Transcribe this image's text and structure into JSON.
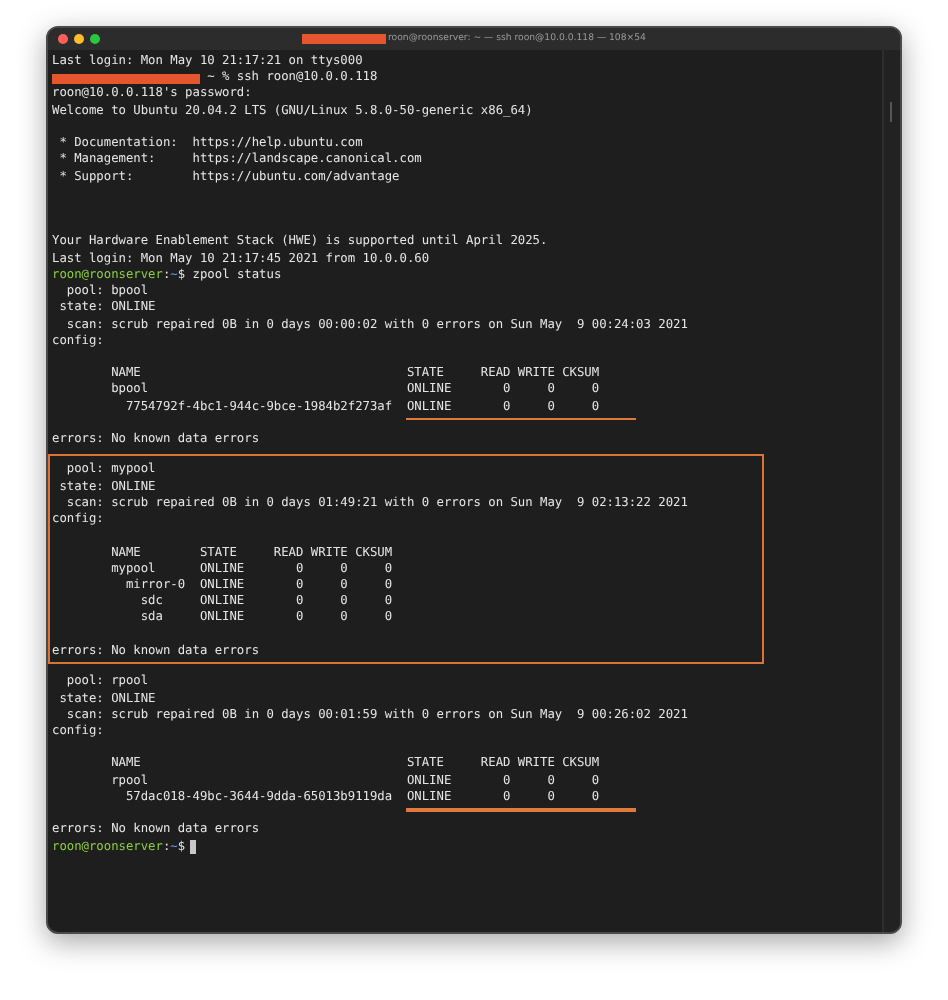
{
  "window": {
    "title": "roon@roonserver: ~ — ssh roon@10.0.0.118 — 108×54",
    "title_redacted": true
  },
  "lines": [
    {
      "kind": "text",
      "text": "Last login: Mon May 10 21:17:21 on ttys000"
    },
    {
      "kind": "redacted",
      "text": "~ % ssh roon@10.0.0.118"
    },
    {
      "kind": "text",
      "text": "roon@10.0.0.118's password:"
    },
    {
      "kind": "text",
      "text": "Welcome to Ubuntu 20.04.2 LTS (GNU/Linux 5.8.0-50-generic x86_64)"
    },
    {
      "kind": "blank"
    },
    {
      "kind": "text",
      "text": " * Documentation:  https://help.ubuntu.com"
    },
    {
      "kind": "text",
      "text": " * Management:     https://landscape.canonical.com"
    },
    {
      "kind": "text",
      "text": " * Support:        https://ubuntu.com/advantage"
    },
    {
      "kind": "blank"
    },
    {
      "kind": "blank"
    },
    {
      "kind": "blank"
    },
    {
      "kind": "text",
      "text": "Your Hardware Enablement Stack (HWE) is supported until April 2025."
    },
    {
      "kind": "text",
      "text": "Last login: Mon May 10 21:17:45 2021 from 10.0.0.60"
    },
    {
      "kind": "prompt",
      "user": "roon@roonserver",
      "separator": ":",
      "path": "~",
      "symbol": "$",
      "command": "zpool status"
    },
    {
      "kind": "text",
      "text": "  pool: bpool"
    },
    {
      "kind": "text",
      "text": " state: ONLINE"
    },
    {
      "kind": "text",
      "text": "  scan: scrub repaired 0B in 0 days 00:00:02 with 0 errors on Sun May  9 00:24:03 2021"
    },
    {
      "kind": "text",
      "text": "config:"
    },
    {
      "kind": "blank"
    },
    {
      "kind": "text",
      "text": "        NAME                                    STATE     READ WRITE CKSUM"
    },
    {
      "kind": "text",
      "text": "        bpool                                   ONLINE       0     0     0"
    },
    {
      "kind": "text",
      "text": "          7754792f-4bc1-944c-9bce-1984b2f273af  ONLINE       0     0     0"
    },
    {
      "kind": "underline"
    },
    {
      "kind": "text",
      "text": "errors: No known data errors"
    },
    {
      "kind": "blank"
    },
    {
      "kind": "box",
      "lines": [
        {
          "kind": "text",
          "text": "  pool: mypool"
        },
        {
          "kind": "text",
          "text": " state: ONLINE"
        },
        {
          "kind": "text",
          "text": "  scan: scrub repaired 0B in 0 days 01:49:21 with 0 errors on Sun May  9 02:13:22 2021"
        },
        {
          "kind": "text",
          "text": "config:"
        },
        {
          "kind": "blank"
        },
        {
          "kind": "text",
          "text": "        NAME        STATE     READ WRITE CKSUM"
        },
        {
          "kind": "text",
          "text": "        mypool      ONLINE       0     0     0"
        },
        {
          "kind": "text",
          "text": "          mirror-0  ONLINE       0     0     0"
        },
        {
          "kind": "text",
          "text": "            sdc     ONLINE       0     0     0"
        },
        {
          "kind": "text",
          "text": "            sda     ONLINE       0     0     0"
        },
        {
          "kind": "blank"
        },
        {
          "kind": "text",
          "text": "errors: No known data errors"
        }
      ]
    },
    {
      "kind": "blank"
    },
    {
      "kind": "text",
      "text": "  pool: rpool"
    },
    {
      "kind": "text",
      "text": " state: ONLINE"
    },
    {
      "kind": "text",
      "text": "  scan: scrub repaired 0B in 0 days 00:01:59 with 0 errors on Sun May  9 00:26:02 2021"
    },
    {
      "kind": "text",
      "text": "config:"
    },
    {
      "kind": "blank"
    },
    {
      "kind": "text",
      "text": "        NAME                                    STATE     READ WRITE CKSUM"
    },
    {
      "kind": "text",
      "text": "        rpool                                   ONLINE       0     0     0"
    },
    {
      "kind": "text",
      "text": "          57dac018-49bc-3644-9dda-65013b9119da  ONLINE       0     0     0"
    },
    {
      "kind": "underline"
    },
    {
      "kind": "text",
      "text": "errors: No known data errors"
    },
    {
      "kind": "prompt",
      "user": "roon@roonserver",
      "separator": ":",
      "path": "~",
      "symbol": "$",
      "cursor": true
    }
  ]
}
